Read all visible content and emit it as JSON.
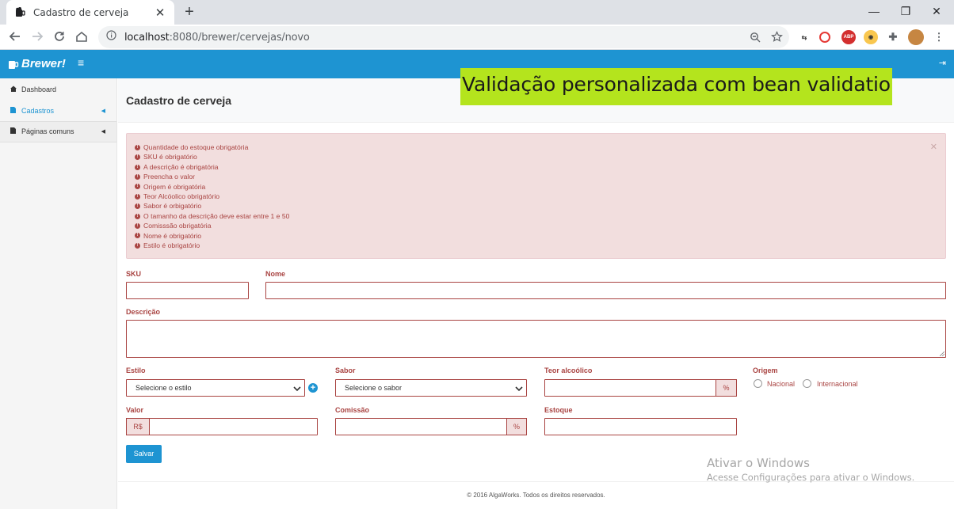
{
  "browser": {
    "tab_title": "Cadastro de cerveja",
    "tab_close": "✕",
    "new_tab": "+",
    "url_host": "localhost",
    "url_rest": ":8080/brewer/cervejas/novo",
    "window_controls": [
      "—",
      "❐",
      "✕"
    ]
  },
  "app": {
    "brand": "Brewer!",
    "menu_icon": "≡",
    "logout_icon": "⇥",
    "accent_color": "#1e94d2"
  },
  "sidebar": {
    "items": [
      {
        "label": "Dashboard",
        "icon": "home-icon"
      },
      {
        "label": "Cadastros",
        "icon": "file-icon"
      },
      {
        "label": "Páginas comuns",
        "icon": "file-icon"
      }
    ]
  },
  "page": {
    "title": "Cadastro de cerveja",
    "banner": "Validação personalizada com bean validation"
  },
  "errors": [
    "Quantidade do estoque obrigatória",
    "SKU é obrigatório",
    "A descrição é obrigatória",
    "Preencha o valor",
    "Origem é obrigatória",
    "Teor Alcóolico obrigatório",
    "Sabor é orbigatório",
    "O tamanho da descrição deve estar entre 1 e 50",
    "Comisssão obrigatória",
    "Nome é obrigatório",
    "Estilo é obrigatório"
  ],
  "form": {
    "sku_label": "SKU",
    "nome_label": "Nome",
    "descricao_label": "Descrição",
    "estilo_label": "Estilo",
    "estilo_value": "Selecione o estilo",
    "sabor_label": "Sabor",
    "sabor_value": "Selecione o sabor",
    "teor_label": "Teor alcoólico",
    "teor_addon": "%",
    "origem_label": "Origem",
    "origem_options": [
      "Nacional",
      "Internacional"
    ],
    "valor_label": "Valor",
    "valor_addon": "R$",
    "comissao_label": "Comissão",
    "comissao_addon": "%",
    "estoque_label": "Estoque",
    "save_label": "Salvar"
  },
  "footer": "© 2016 AlgaWorks. Todos os direitos reservados.",
  "watermark": {
    "line1": "Ativar o Windows",
    "line2": "Acesse Configurações para ativar o Windows."
  }
}
